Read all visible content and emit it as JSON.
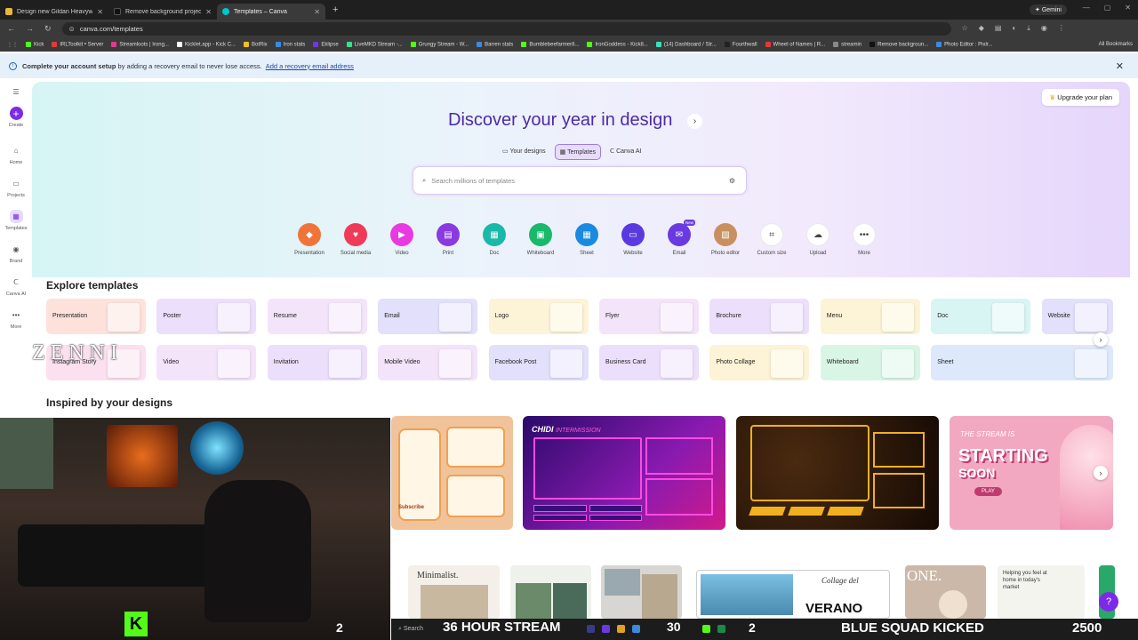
{
  "browser": {
    "tabs": [
      {
        "title": "Design new Gildan Heavyweig",
        "color": "#e8b838"
      },
      {
        "title": "Remove background project - ",
        "color": "#111111"
      },
      {
        "title": "Templates – Canva",
        "color": "#00c4cc"
      }
    ],
    "new_tab": "+",
    "gemini": "Gemini",
    "url": "canva.com/templates",
    "bookmarks": [
      {
        "label": "Kick",
        "color": "#53fc18"
      },
      {
        "label": "IRLToolkit • Server",
        "color": "#e03a3a"
      },
      {
        "label": "Streamloots | Irong...",
        "color": "#e03a8a"
      },
      {
        "label": "Kicklet.app - Kick C...",
        "color": "#ffffff"
      },
      {
        "label": "BotRix",
        "color": "#f0c020"
      },
      {
        "label": "Iron stats",
        "color": "#3a8ae0"
      },
      {
        "label": "Eklipse",
        "color": "#6a3ae0"
      },
      {
        "label": "LiveMKD Stream -...",
        "color": "#3ae08a"
      },
      {
        "label": "Grungy Stream - W...",
        "color": "#53fc18"
      },
      {
        "label": "Barren stats",
        "color": "#3a8ae0"
      },
      {
        "label": "Bumblebeefarmer8...",
        "color": "#53fc18"
      },
      {
        "label": "IronGoddess - Kick8...",
        "color": "#53fc18"
      },
      {
        "label": "(14) Dashboard / Str...",
        "color": "#3ae0c0"
      },
      {
        "label": "Fourthwall",
        "color": "#222222"
      },
      {
        "label": "Wheel of Names | R...",
        "color": "#e03a3a"
      },
      {
        "label": "streamin",
        "color": "#888888"
      },
      {
        "label": "Remove backgroun...",
        "color": "#111111"
      },
      {
        "label": "Photo Editor : Pixlr...",
        "color": "#3a8ae0"
      }
    ],
    "all_bookmarks": "All Bookmarks"
  },
  "notice": {
    "bold": "Complete your account setup",
    "text": "by adding a recovery email to never lose access.",
    "link": "Add a recovery email address",
    "close": "✕"
  },
  "sidebar": {
    "items": [
      {
        "label": "Create",
        "icon": "+"
      },
      {
        "label": "Home",
        "icon": "⌂"
      },
      {
        "label": "Projects",
        "icon": "▭"
      },
      {
        "label": "Templates",
        "icon": "▦"
      },
      {
        "label": "Brand",
        "icon": "◉"
      },
      {
        "label": "Canva AI",
        "icon": "ᑕ"
      },
      {
        "label": "More",
        "icon": "•••"
      }
    ]
  },
  "hero": {
    "upgrade": "Upgrade your plan",
    "title": "Discover your year in design",
    "arrow": "›",
    "pills": [
      "Your designs",
      "Templates",
      "Canva AI"
    ],
    "search_placeholder": "Search millions of templates"
  },
  "categories": [
    {
      "label": "Presentation",
      "color": "#f0743a",
      "icon": "◆"
    },
    {
      "label": "Social media",
      "color": "#f03a5a",
      "icon": "♥"
    },
    {
      "label": "Video",
      "color": "#e83ae0",
      "icon": "▶"
    },
    {
      "label": "Print",
      "color": "#8a3ae0",
      "icon": "▤"
    },
    {
      "label": "Doc",
      "color": "#1ab8a8",
      "icon": "▦"
    },
    {
      "label": "Whiteboard",
      "color": "#1ab86a",
      "icon": "▣"
    },
    {
      "label": "Sheet",
      "color": "#1a8ae0",
      "icon": "▦"
    },
    {
      "label": "Website",
      "color": "#5a3ae0",
      "icon": "▭"
    },
    {
      "label": "Email",
      "color": "#6a3ae0",
      "icon": "✉",
      "badge": "New"
    },
    {
      "label": "Photo editor",
      "color": "#c89060",
      "icon": "▨"
    },
    {
      "label": "Custom size",
      "color": "#ffffff",
      "icon": "⌗"
    },
    {
      "label": "Upload",
      "color": "#ffffff",
      "icon": "☁"
    },
    {
      "label": "More",
      "color": "#ffffff",
      "icon": "•••"
    }
  ],
  "explore": {
    "title": "Explore templates",
    "row1": [
      {
        "label": "Presentation",
        "color": "#fde2dc"
      },
      {
        "label": "Poster",
        "color": "#ecdffb"
      },
      {
        "label": "Resume",
        "color": "#f3e4fa"
      },
      {
        "label": "Email",
        "color": "#e2e0fb"
      },
      {
        "label": "Logo",
        "color": "#fdf3d6"
      },
      {
        "label": "Flyer",
        "color": "#f3e4fa"
      },
      {
        "label": "Brochure",
        "color": "#ecdffb"
      },
      {
        "label": "Menu",
        "color": "#fdf3d6"
      },
      {
        "label": "Doc",
        "color": "#d9f5f3"
      },
      {
        "label": "Website",
        "color": "#e2e0fb"
      }
    ],
    "row2": [
      {
        "label": "Instagram Story",
        "color": "#fbe0ef"
      },
      {
        "label": "Video",
        "color": "#f3e4fa"
      },
      {
        "label": "Invitation",
        "color": "#ecdffb"
      },
      {
        "label": "Mobile Video",
        "color": "#f3e4fa"
      },
      {
        "label": "Facebook Post",
        "color": "#e2e0fb"
      },
      {
        "label": "Business Card",
        "color": "#ecdffb"
      },
      {
        "label": "Photo Collage",
        "color": "#fdf3d6"
      },
      {
        "label": "Whiteboard",
        "color": "#d9f5e6"
      },
      {
        "label": "Sheet",
        "color": "#dde9fb"
      }
    ],
    "next": "›"
  },
  "overlay": {
    "zenni": "ZENNI"
  },
  "inspired": {
    "title": "Inspired by your designs",
    "next": "›",
    "d1_sub": "Subscribe",
    "d2_brand": "CHIDI",
    "d2_brand_sub": "INTERMISSION",
    "d4_t1": "THE STREAM IS",
    "d4_t2": "STARTING",
    "d4_t3": "SOON",
    "d4_play": "PLAY"
  },
  "bottom": {
    "minimalist": "Minimalist.",
    "verano": "VERANO",
    "collage": "Collage del",
    "one": "ONE.",
    "helping": "Helping you feel at home in today's market"
  },
  "stream": {
    "kick": "K",
    "n1": "2",
    "search": "Search",
    "title": "36 HOUR STREAM",
    "n2": "30",
    "n3": "2",
    "squad": "BLUE SQUAD KICKED",
    "score": "2500",
    "help": "?"
  }
}
